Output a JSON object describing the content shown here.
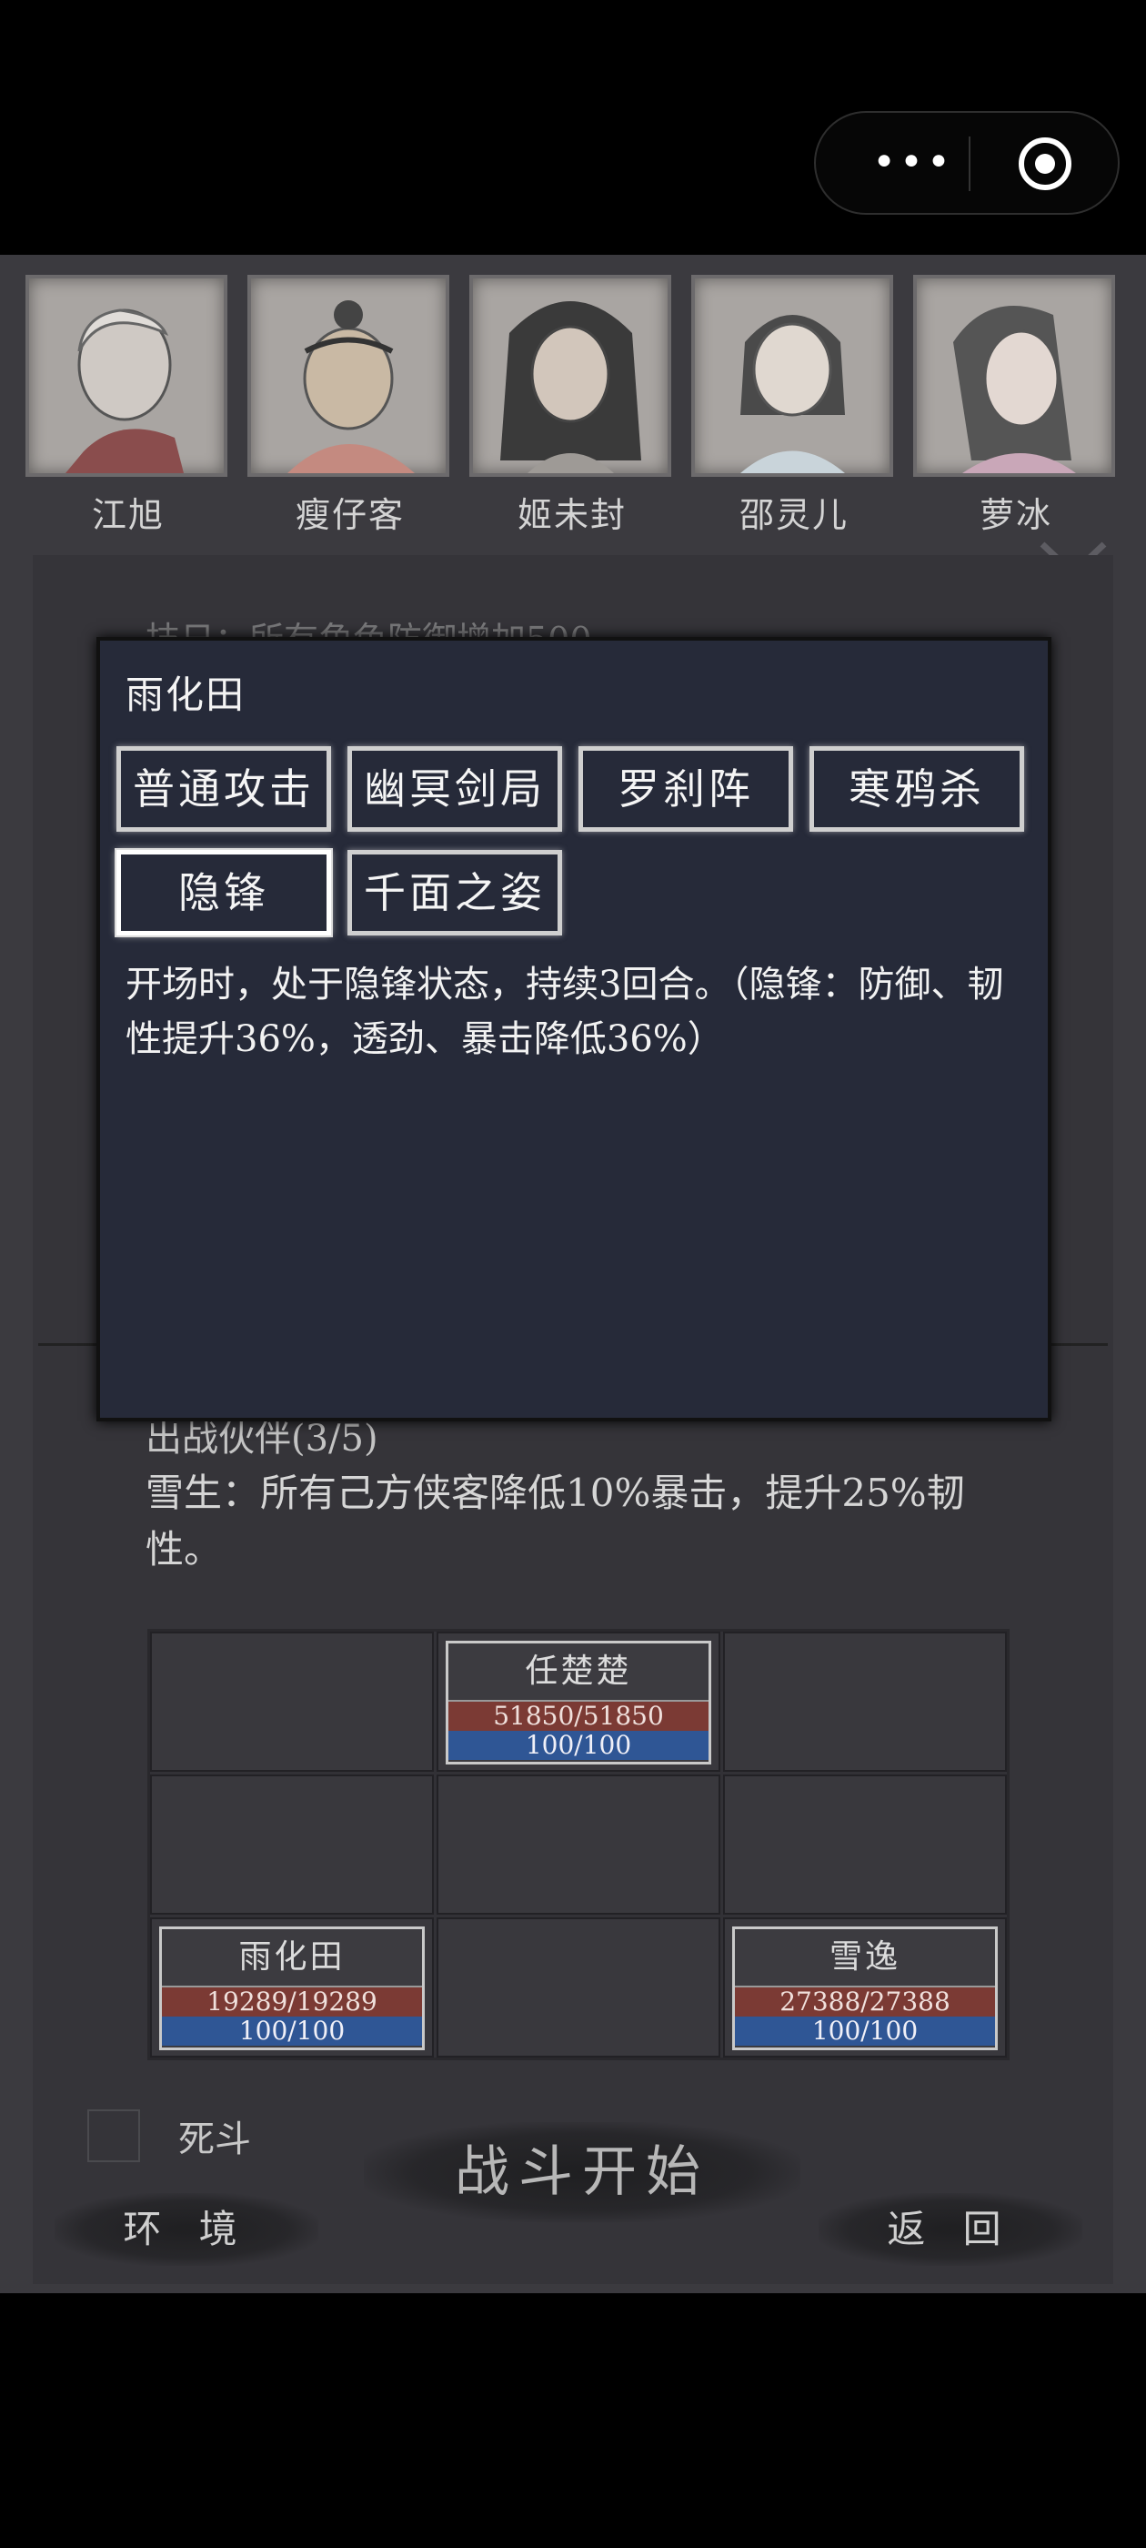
{
  "heroes": [
    {
      "name": "江旭"
    },
    {
      "name": "瘦仔客"
    },
    {
      "name": "姬未封"
    },
    {
      "name": "邵灵儿"
    },
    {
      "name": "萝冰"
    }
  ],
  "background": {
    "ghost_text": "技日：所有角色防御增加500",
    "partners_title": "出战伙伴(3/5)",
    "skill_desc": "雪生：所有己方侠客降低10%暴击，提升25%韧性。"
  },
  "modal": {
    "title": "雨化田",
    "skills": [
      "普通攻击",
      "幽冥剑局",
      "罗刹阵",
      "寒鸦杀",
      "隐锋",
      "千面之姿"
    ],
    "selected_skill": "隐锋",
    "description": "开场时，处于隐锋状态，持续3回合。（隐锋：防御、韧性提升36%，透劲、暴击降低36%）"
  },
  "formation": {
    "units": [
      {
        "name": "任楚楚",
        "hp": "51850/51850",
        "mp": "100/100"
      },
      {
        "name": "雨化田",
        "hp": "19289/19289",
        "mp": "100/100"
      },
      {
        "name": "雪逸",
        "hp": "27388/27388",
        "mp": "100/100"
      }
    ]
  },
  "controls": {
    "death_match_label": "死斗",
    "start_label": "战斗开始",
    "environment_label": "环 境",
    "back_label": "返 回"
  },
  "system": {
    "menu_dots": "•••"
  },
  "colors": {
    "panel": "#3b3a3f",
    "modal": "#262a39",
    "hp_bar": "#7b3a34",
    "mp_bar": "#2f5695"
  }
}
